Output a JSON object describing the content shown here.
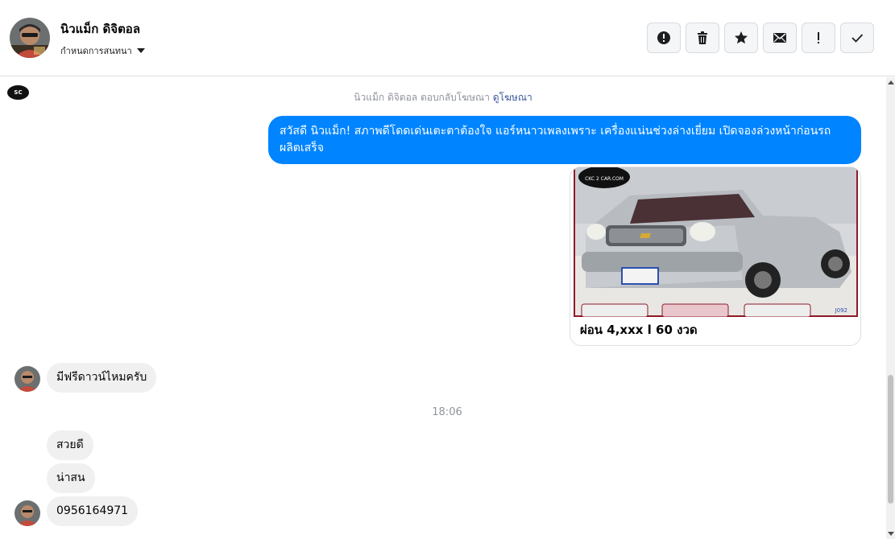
{
  "header": {
    "name": "นิวแม็ก ดิจิตอล",
    "subtitle": "กำหนดการสนทนา"
  },
  "actions": [
    {
      "name": "report-icon",
      "label": "!"
    },
    {
      "name": "trash-icon"
    },
    {
      "name": "star-icon"
    },
    {
      "name": "envelope-icon"
    },
    {
      "name": "exclamation-icon",
      "label": "!"
    },
    {
      "name": "check-icon"
    }
  ],
  "page_logo": "SC",
  "ad_notice": {
    "text": "นิวแม็ก ดิจิตอล ตอบกลับโฆษณา",
    "link": "ดูโฆษณา"
  },
  "messages": {
    "outgoing": "สวัสดี นิวแม็ก! สภาพดีโดดเด่นเตะตาต้องใจ แอร์หนาวเพลงเพราะ เครื่องแน่นช่วงล่างเยี่ยม เปิดจองล่วงหน้าก่อนรถผลิตเสร็จ",
    "card_caption": "ผ่อน 4,xxx l 60 งวด",
    "card_brand": "CKC 2 CAR.COM",
    "card_code": "J092",
    "incoming_1": "มีฟรีดาวน์ไหมครับ",
    "timestamp": "18:06",
    "incoming_2": "สวยดี",
    "incoming_3": "น่าสน",
    "incoming_4": "0956164971"
  },
  "colors": {
    "accent": "#0084ff",
    "incoming_bubble": "#f1f0f0",
    "link": "#385898"
  }
}
